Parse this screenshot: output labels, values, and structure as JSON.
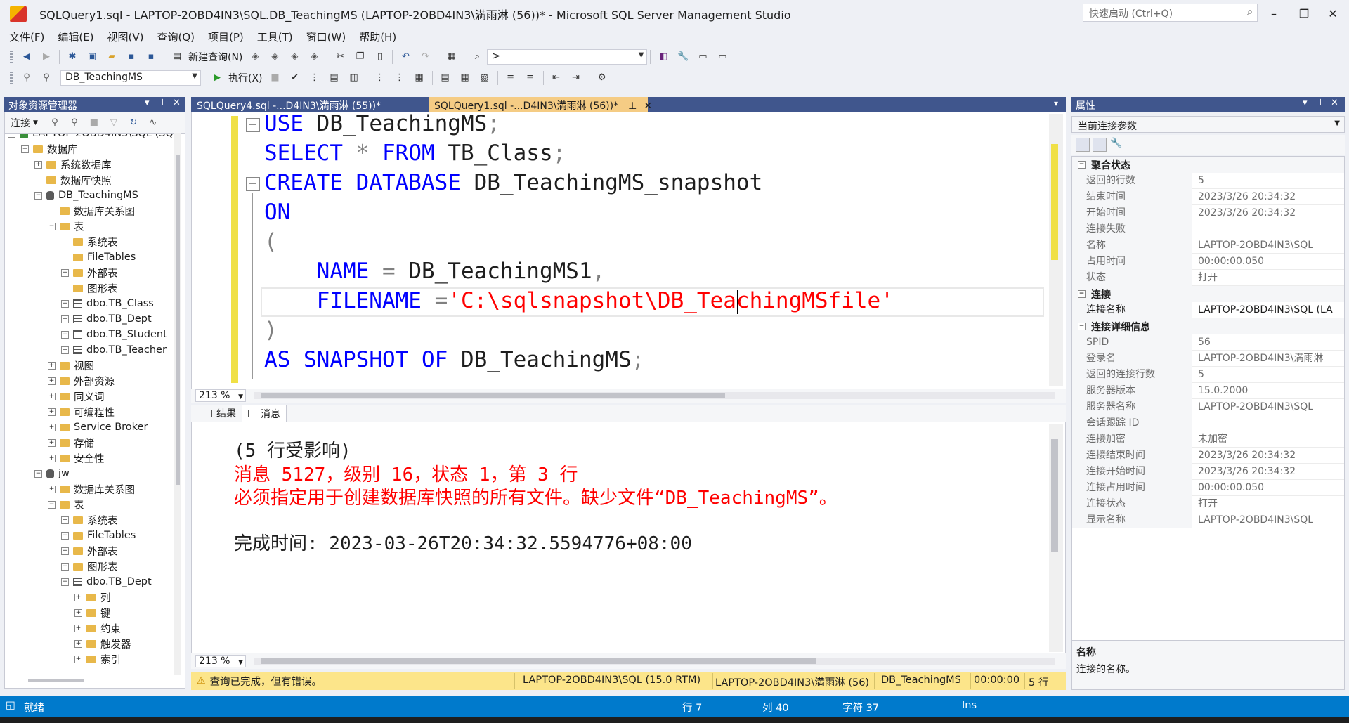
{
  "window": {
    "title": "SQLQuery1.sql - LAPTOP-2OBD4IN3\\SQL.DB_TeachingMS (LAPTOP-2OBD4IN3\\満雨淋 (56))* - Microsoft SQL Server Management Studio",
    "quick_launch_placeholder": "快速启动 (Ctrl+Q)"
  },
  "menu": [
    "文件(F)",
    "编辑(E)",
    "视图(V)",
    "查询(Q)",
    "项目(P)",
    "工具(T)",
    "窗口(W)",
    "帮助(H)"
  ],
  "toolbar": {
    "new_query_label": "新建查询(N)",
    "target_combo_value": ">",
    "database_combo_value": "DB_TeachingMS",
    "execute_label": "执行(X)",
    "accent_color": "#2b5797"
  },
  "object_explorer": {
    "title": "对象资源管理器",
    "connect_label": "连接",
    "tree": [
      {
        "label": "LAPTOP-2OBD4IN3\\SQL (SQL",
        "icon": "server-icon",
        "expander": "-",
        "level": 0
      },
      {
        "label": "数据库",
        "icon": "folder-icon",
        "expander": "-",
        "level": 1
      },
      {
        "label": "系统数据库",
        "icon": "folder-icon",
        "expander": "+",
        "level": 2
      },
      {
        "label": "数据库快照",
        "icon": "folder-icon",
        "expander": "",
        "level": 2
      },
      {
        "label": "DB_TeachingMS",
        "icon": "database-icon",
        "expander": "-",
        "level": 2
      },
      {
        "label": "数据库关系图",
        "icon": "folder-icon",
        "expander": "",
        "level": 3
      },
      {
        "label": "表",
        "icon": "folder-icon",
        "expander": "-",
        "level": 3
      },
      {
        "label": "系统表",
        "icon": "folder-icon",
        "expander": "",
        "level": 4
      },
      {
        "label": "FileTables",
        "icon": "folder-icon",
        "expander": "",
        "level": 4
      },
      {
        "label": "外部表",
        "icon": "folder-icon",
        "expander": "+",
        "level": 4
      },
      {
        "label": "图形表",
        "icon": "folder-icon",
        "expander": "",
        "level": 4
      },
      {
        "label": "dbo.TB_Class",
        "icon": "table-icon",
        "expander": "+",
        "level": 4
      },
      {
        "label": "dbo.TB_Dept",
        "icon": "table-icon",
        "expander": "+",
        "level": 4
      },
      {
        "label": "dbo.TB_Student",
        "icon": "table-icon",
        "expander": "+",
        "level": 4
      },
      {
        "label": "dbo.TB_Teacher",
        "icon": "table-icon",
        "expander": "+",
        "level": 4
      },
      {
        "label": "视图",
        "icon": "folder-icon",
        "expander": "+",
        "level": 3
      },
      {
        "label": "外部资源",
        "icon": "folder-icon",
        "expander": "+",
        "level": 3
      },
      {
        "label": "同义词",
        "icon": "folder-icon",
        "expander": "+",
        "level": 3
      },
      {
        "label": "可编程性",
        "icon": "folder-icon",
        "expander": "+",
        "level": 3
      },
      {
        "label": "Service Broker",
        "icon": "folder-icon",
        "expander": "+",
        "level": 3
      },
      {
        "label": "存储",
        "icon": "folder-icon",
        "expander": "+",
        "level": 3
      },
      {
        "label": "安全性",
        "icon": "folder-icon",
        "expander": "+",
        "level": 3
      },
      {
        "label": "jw",
        "icon": "database-icon",
        "expander": "-",
        "level": 2
      },
      {
        "label": "数据库关系图",
        "icon": "folder-icon",
        "expander": "+",
        "level": 3
      },
      {
        "label": "表",
        "icon": "folder-icon",
        "expander": "-",
        "level": 3
      },
      {
        "label": "系统表",
        "icon": "folder-icon",
        "expander": "+",
        "level": 4
      },
      {
        "label": "FileTables",
        "icon": "folder-icon",
        "expander": "+",
        "level": 4
      },
      {
        "label": "外部表",
        "icon": "folder-icon",
        "expander": "+",
        "level": 4
      },
      {
        "label": "图形表",
        "icon": "folder-icon",
        "expander": "+",
        "level": 4
      },
      {
        "label": "dbo.TB_Dept",
        "icon": "table-icon",
        "expander": "-",
        "level": 4
      },
      {
        "label": "列",
        "icon": "folder-icon",
        "expander": "+",
        "level": 5
      },
      {
        "label": "键",
        "icon": "folder-icon",
        "expander": "+",
        "level": 5
      },
      {
        "label": "约束",
        "icon": "folder-icon",
        "expander": "+",
        "level": 5
      },
      {
        "label": "触发器",
        "icon": "folder-icon",
        "expander": "+",
        "level": 5
      },
      {
        "label": "索引",
        "icon": "folder-icon",
        "expander": "+",
        "level": 5
      }
    ]
  },
  "tabs": [
    {
      "label": "SQLQuery4.sql -...D4IN3\\満雨淋 (55))*",
      "active": false
    },
    {
      "label": "SQLQuery1.sql -...D4IN3\\満雨淋 (56))*",
      "active": true
    }
  ],
  "editor": {
    "lines": [
      [
        {
          "t": "USE",
          "c": "kw"
        },
        {
          "t": " DB_TeachingMS",
          "c": ""
        },
        {
          "t": ";",
          "c": "gray"
        }
      ],
      [
        {
          "t": "SELECT",
          "c": "kw"
        },
        {
          "t": " ",
          "c": ""
        },
        {
          "t": "*",
          "c": "gray"
        },
        {
          "t": " ",
          "c": ""
        },
        {
          "t": "FROM",
          "c": "kw"
        },
        {
          "t": " TB_Class",
          "c": ""
        },
        {
          "t": ";",
          "c": "gray"
        }
      ],
      [
        {
          "t": "CREATE",
          "c": "kw"
        },
        {
          "t": " ",
          "c": ""
        },
        {
          "t": "DATABASE",
          "c": "kw"
        },
        {
          "t": " DB_TeachingMS_snapshot",
          "c": ""
        }
      ],
      [
        {
          "t": "ON",
          "c": "kw"
        }
      ],
      [
        {
          "t": "(",
          "c": "gray"
        }
      ],
      [
        {
          "t": "    ",
          "c": ""
        },
        {
          "t": "NAME",
          "c": "kw"
        },
        {
          "t": " ",
          "c": ""
        },
        {
          "t": "=",
          "c": "gray"
        },
        {
          "t": " DB_TeachingMS1",
          "c": ""
        },
        {
          "t": ",",
          "c": "gray"
        }
      ],
      [
        {
          "t": "    ",
          "c": ""
        },
        {
          "t": "FILENAME",
          "c": "kw"
        },
        {
          "t": " ",
          "c": ""
        },
        {
          "t": "=",
          "c": "gray"
        },
        {
          "t": "'C:\\sqlsnapshot\\DB_TeachingMSfile'",
          "c": "str"
        }
      ],
      [
        {
          "t": ")",
          "c": "gray"
        }
      ],
      [
        {
          "t": "AS",
          "c": "kw"
        },
        {
          "t": " ",
          "c": ""
        },
        {
          "t": "SNAPSHOT",
          "c": "kw"
        },
        {
          "t": " ",
          "c": ""
        },
        {
          "t": "OF",
          "c": "kw"
        },
        {
          "t": " DB_TeachingMS",
          "c": ""
        },
        {
          "t": ";",
          "c": "gray"
        }
      ]
    ],
    "zoom": "213 %",
    "keyword_color": "#0000ff",
    "string_color": "#ff0000"
  },
  "results": {
    "tabs": [
      "结果",
      "消息"
    ],
    "messages": [
      {
        "text": "(5 行受影响)",
        "color": "black"
      },
      {
        "text": "消息 5127，级别 16，状态 1，第 3 行",
        "color": "red"
      },
      {
        "text": "必须指定用于创建数据库快照的所有文件。缺少文件“DB_TeachingMS”。",
        "color": "red"
      },
      {
        "text": "",
        "color": "black"
      },
      {
        "text": "完成时间: 2023-03-26T20:34:32.5594776+08:00",
        "color": "black"
      }
    ],
    "zoom": "213 %"
  },
  "query_status": {
    "message": "查询已完成，但有错误。",
    "server": "LAPTOP-2OBD4IN3\\SQL (15.0 RTM)",
    "user": "LAPTOP-2OBD4IN3\\満雨淋 (56)",
    "database": "DB_TeachingMS",
    "elapsed": "00:00:00",
    "rows": "5 行",
    "background": "#fce58a"
  },
  "properties": {
    "title": "属性",
    "combo_value": "当前连接参数",
    "sections": [
      {
        "name": "聚合状态",
        "rows": [
          {
            "name": "返回的行数",
            "value": "5"
          },
          {
            "name": "结束时间",
            "value": "2023/3/26 20:34:32"
          },
          {
            "name": "开始时间",
            "value": "2023/3/26 20:34:32"
          },
          {
            "name": "连接失败",
            "value": ""
          },
          {
            "name": "名称",
            "value": "LAPTOP-2OBD4IN3\\SQL"
          },
          {
            "name": "占用时间",
            "value": "00:00:00.050"
          },
          {
            "name": "状态",
            "value": "打开"
          }
        ]
      },
      {
        "name": "连接",
        "rows": [
          {
            "name": "连接名称",
            "value": "LAPTOP-2OBD4IN3\\SQL (LA",
            "dark": true
          }
        ]
      },
      {
        "name": "连接详细信息",
        "rows": [
          {
            "name": "SPID",
            "value": "56"
          },
          {
            "name": "登录名",
            "value": "LAPTOP-2OBD4IN3\\満雨淋"
          },
          {
            "name": "返回的连接行数",
            "value": "5"
          },
          {
            "name": "服务器版本",
            "value": "15.0.2000"
          },
          {
            "name": "服务器名称",
            "value": "LAPTOP-2OBD4IN3\\SQL"
          },
          {
            "name": "会话跟踪 ID",
            "value": ""
          },
          {
            "name": "连接加密",
            "value": "未加密"
          },
          {
            "name": "连接结束时间",
            "value": "2023/3/26 20:34:32"
          },
          {
            "name": "连接开始时间",
            "value": "2023/3/26 20:34:32"
          },
          {
            "name": "连接占用时间",
            "value": "00:00:00.050"
          },
          {
            "name": "连接状态",
            "value": "打开"
          },
          {
            "name": "显示名称",
            "value": "LAPTOP-2OBD4IN3\\SQL"
          }
        ]
      }
    ],
    "description_title": "名称",
    "description_text": "连接的名称。"
  },
  "statusbar": {
    "ready": "就绪",
    "line": "行 7",
    "column": "列 40",
    "char": "字符 37",
    "mode": "Ins",
    "color": "#007acc"
  }
}
